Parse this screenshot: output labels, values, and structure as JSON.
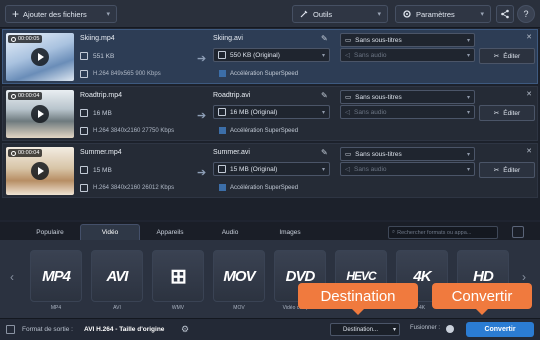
{
  "toolbar": {
    "add_files_label": "Ajouter des fichiers",
    "tools_label": "Outils",
    "settings_label": "Paramètres",
    "share_icon": "share-icon",
    "help_label": "?"
  },
  "files": [
    {
      "timecode": "00:00:05",
      "name": "Skiing.mp4",
      "size": "551 KB",
      "codec": "H.264 849x565 900 Kbps",
      "output_name": "Skiing.avi",
      "output_size": "550 KB (Original)",
      "accel": "Accélération SuperSpeed",
      "subtitles": "Sans sous-titres",
      "audio": "Sans audio",
      "edit": "Éditer",
      "selected": true
    },
    {
      "timecode": "00:00:04",
      "name": "Roadtrip.mp4",
      "size": "16 MB",
      "codec": "H.264 3840x2160 27750 Kbps",
      "output_name": "Roadtrip.avi",
      "output_size": "16 MB (Original)",
      "accel": "Accélération SuperSpeed",
      "subtitles": "Sans sous-titres",
      "audio": "Sans audio",
      "edit": "Éditer",
      "selected": false
    },
    {
      "timecode": "00:00:04",
      "name": "Summer.mp4",
      "size": "15 MB",
      "codec": "H.264 3840x2160 26012 Kbps",
      "output_name": "Summer.avi",
      "output_size": "15 MB (Original)",
      "accel": "Accélération SuperSpeed",
      "subtitles": "Sans sous-titres",
      "audio": "Sans audio",
      "edit": "Éditer",
      "selected": false
    }
  ],
  "tabs": [
    "Populaire",
    "Vidéo",
    "Appareils",
    "Audio",
    "Images"
  ],
  "active_tab": "Vidéo",
  "search_placeholder": "Rechercher formats ou appa...",
  "formats": [
    {
      "logo": "MP4",
      "caption": "MP4"
    },
    {
      "logo": "AVI",
      "caption": "AVI"
    },
    {
      "logo": "⊞",
      "caption": "WMV"
    },
    {
      "logo": "MOV",
      "caption": "MOV"
    },
    {
      "logo": "DVD",
      "caption": "Vidéo compat..."
    },
    {
      "logo": "HEVC",
      "caption": "HEVC"
    },
    {
      "logo": "4K",
      "caption": "4K"
    },
    {
      "logo": "HD",
      "caption": "HD"
    }
  ],
  "callouts": {
    "destination": "Destination",
    "convert": "Convertir"
  },
  "status": {
    "format_label": "Format de sortie :",
    "format_value": "AVI H.264 - Taille d'origine",
    "destination": "Destination...",
    "merge_label": "Fusionner :",
    "convert_label": "Convertir"
  },
  "colors": {
    "accent": "#2b7cd3",
    "callout": "#f07a3e",
    "selected_row": "#2d3d55"
  }
}
